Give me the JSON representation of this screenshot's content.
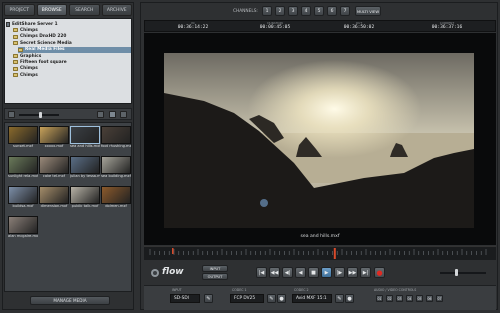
{
  "tabs": [
    "PROJECT",
    "BROWSE",
    "SEARCH",
    "ARCHIVE"
  ],
  "active_tab": "BROWSE",
  "tree": [
    {
      "label": "EditShare Server 1",
      "kind": "server",
      "indent": 0,
      "selected": false
    },
    {
      "label": "Chimps",
      "kind": "folder",
      "indent": 1,
      "selected": false
    },
    {
      "label": "Chimps DnxHD 220",
      "kind": "folder",
      "indent": 1,
      "selected": false
    },
    {
      "label": "Secret Science Media",
      "kind": "folder",
      "indent": 1,
      "selected": false
    },
    {
      "label": "Real Media Files",
      "kind": "folder",
      "indent": 2,
      "selected": true
    },
    {
      "label": "Graphics",
      "kind": "folder",
      "indent": 1,
      "selected": false
    },
    {
      "label": "Fifteen foot square",
      "kind": "folder",
      "indent": 1,
      "selected": false
    },
    {
      "label": "Chimps",
      "kind": "folder",
      "indent": 1,
      "selected": false
    },
    {
      "label": "Chimps",
      "kind": "folder",
      "indent": 1,
      "selected": false
    }
  ],
  "thumbnails": [
    {
      "caption": "sunset.mxf",
      "color": "#8a6a2c"
    },
    {
      "caption": "xxxxx.mxf",
      "color": "#c8a25a"
    },
    {
      "caption": "sea and hills.mxf",
      "color": "#3a3f44",
      "selected": true
    },
    {
      "caption": "foot rhushing.mxf",
      "color": "#4a4038"
    },
    {
      "caption": "sunlight rela.mxf",
      "color": "#6a7a5a"
    },
    {
      "caption": "cake tel.mxf",
      "color": "#9a8a7a"
    },
    {
      "caption": "julian by tessa.mxf",
      "color": "#5a6e86"
    },
    {
      "caption": "sea building.mxf",
      "color": "#a6a49a"
    },
    {
      "caption": "buildsa.mxf",
      "color": "#7d8fa8"
    },
    {
      "caption": "dimension.mxf",
      "color": "#a48d6a"
    },
    {
      "caption": "public talk.mxf",
      "color": "#b7b2a6"
    },
    {
      "caption": "dolmen.mxf",
      "color": "#8c5a2c"
    },
    {
      "caption": "alan mcgaire.mxf",
      "color": "#8a7f78"
    }
  ],
  "manage_media": "MANAGE MEDIA",
  "channels_label": "CHANNELS:",
  "channels": [
    "1",
    "2",
    "3",
    "4",
    "5",
    "6",
    "7"
  ],
  "multiview": "MULTI VIEW",
  "timecodes": [
    {
      "label": "IN",
      "value": "00:36:14:22"
    },
    {
      "label": "DURATION",
      "value": "00:00:45:05"
    },
    {
      "label": "OUT",
      "value": "00:36:50:02"
    },
    {
      "label": "CURRENT",
      "value": "00:36:37:16"
    }
  ],
  "clip_name": "sea and hills.mxf",
  "logo": "flow",
  "input_btn": "INPUT",
  "output_btn": "OUTPUT",
  "transport": [
    "|◀",
    "◀◀",
    "◀|",
    "◀",
    "■",
    "▶",
    "|▶",
    "▶▶",
    "▶|"
  ],
  "record": "●",
  "playhead": 0.55,
  "volume": 0.35,
  "input_section": {
    "label": "INPUT",
    "value": "SD-SDI"
  },
  "codec1_section": {
    "label": "CODEC 1",
    "value": "FCP DV25"
  },
  "codec2_section": {
    "label": "CODEC 2",
    "value": "Avid MXF 15:1"
  },
  "audio_section": {
    "label": "AUDIO / VIDEO CONTROLS",
    "channels": [
      "01",
      "02",
      "03",
      "04",
      "05",
      "06",
      "07"
    ]
  }
}
